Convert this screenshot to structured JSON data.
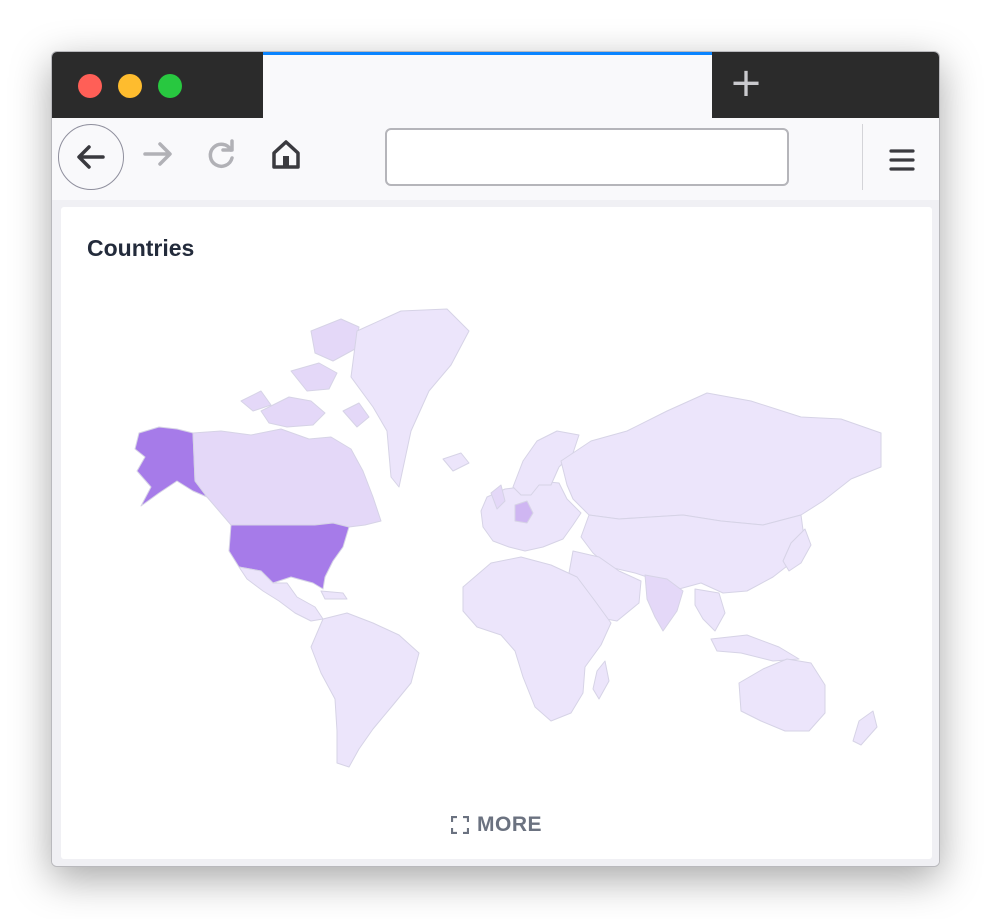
{
  "browser": {
    "traffic_lights": {
      "close": "#ff5f57",
      "minimize": "#febc2e",
      "maximize": "#28c840"
    },
    "tab_accent": "#0a84ff",
    "new_tab_label": "+",
    "url": ""
  },
  "toolbar_icons": [
    "back-arrow-icon",
    "forward-arrow-icon",
    "reload-icon",
    "home-icon",
    "menu-icon"
  ],
  "card": {
    "title": "Countries",
    "more_label": "MORE"
  },
  "map_colors": {
    "high": "#a67be9",
    "medium": "#cfb6f2",
    "low": "#e4d8f8",
    "default": "#ece5fb",
    "border": "#d6d3e6"
  },
  "highlighted_countries": [
    "United States",
    "Canada",
    "Germany",
    "India"
  ]
}
